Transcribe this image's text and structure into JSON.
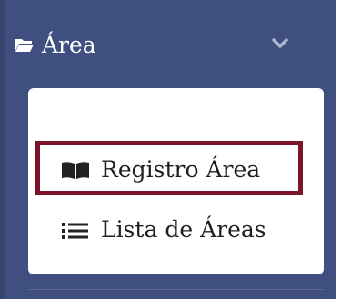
{
  "menu": {
    "title": "Área",
    "icon": "folder-open-icon",
    "expanded_icon": "chevron-down-icon"
  },
  "submenu": {
    "items": [
      {
        "label": "Registro Área",
        "icon": "book-icon",
        "highlighted": true
      },
      {
        "label": "Lista de Áreas",
        "icon": "list-icon",
        "highlighted": false
      }
    ]
  },
  "colors": {
    "sidebar": "#3f4f80",
    "panel": "#ffffff",
    "highlight_border": "#7b1428",
    "text_light": "#ffffff",
    "text_dark": "#1f1f1f"
  }
}
